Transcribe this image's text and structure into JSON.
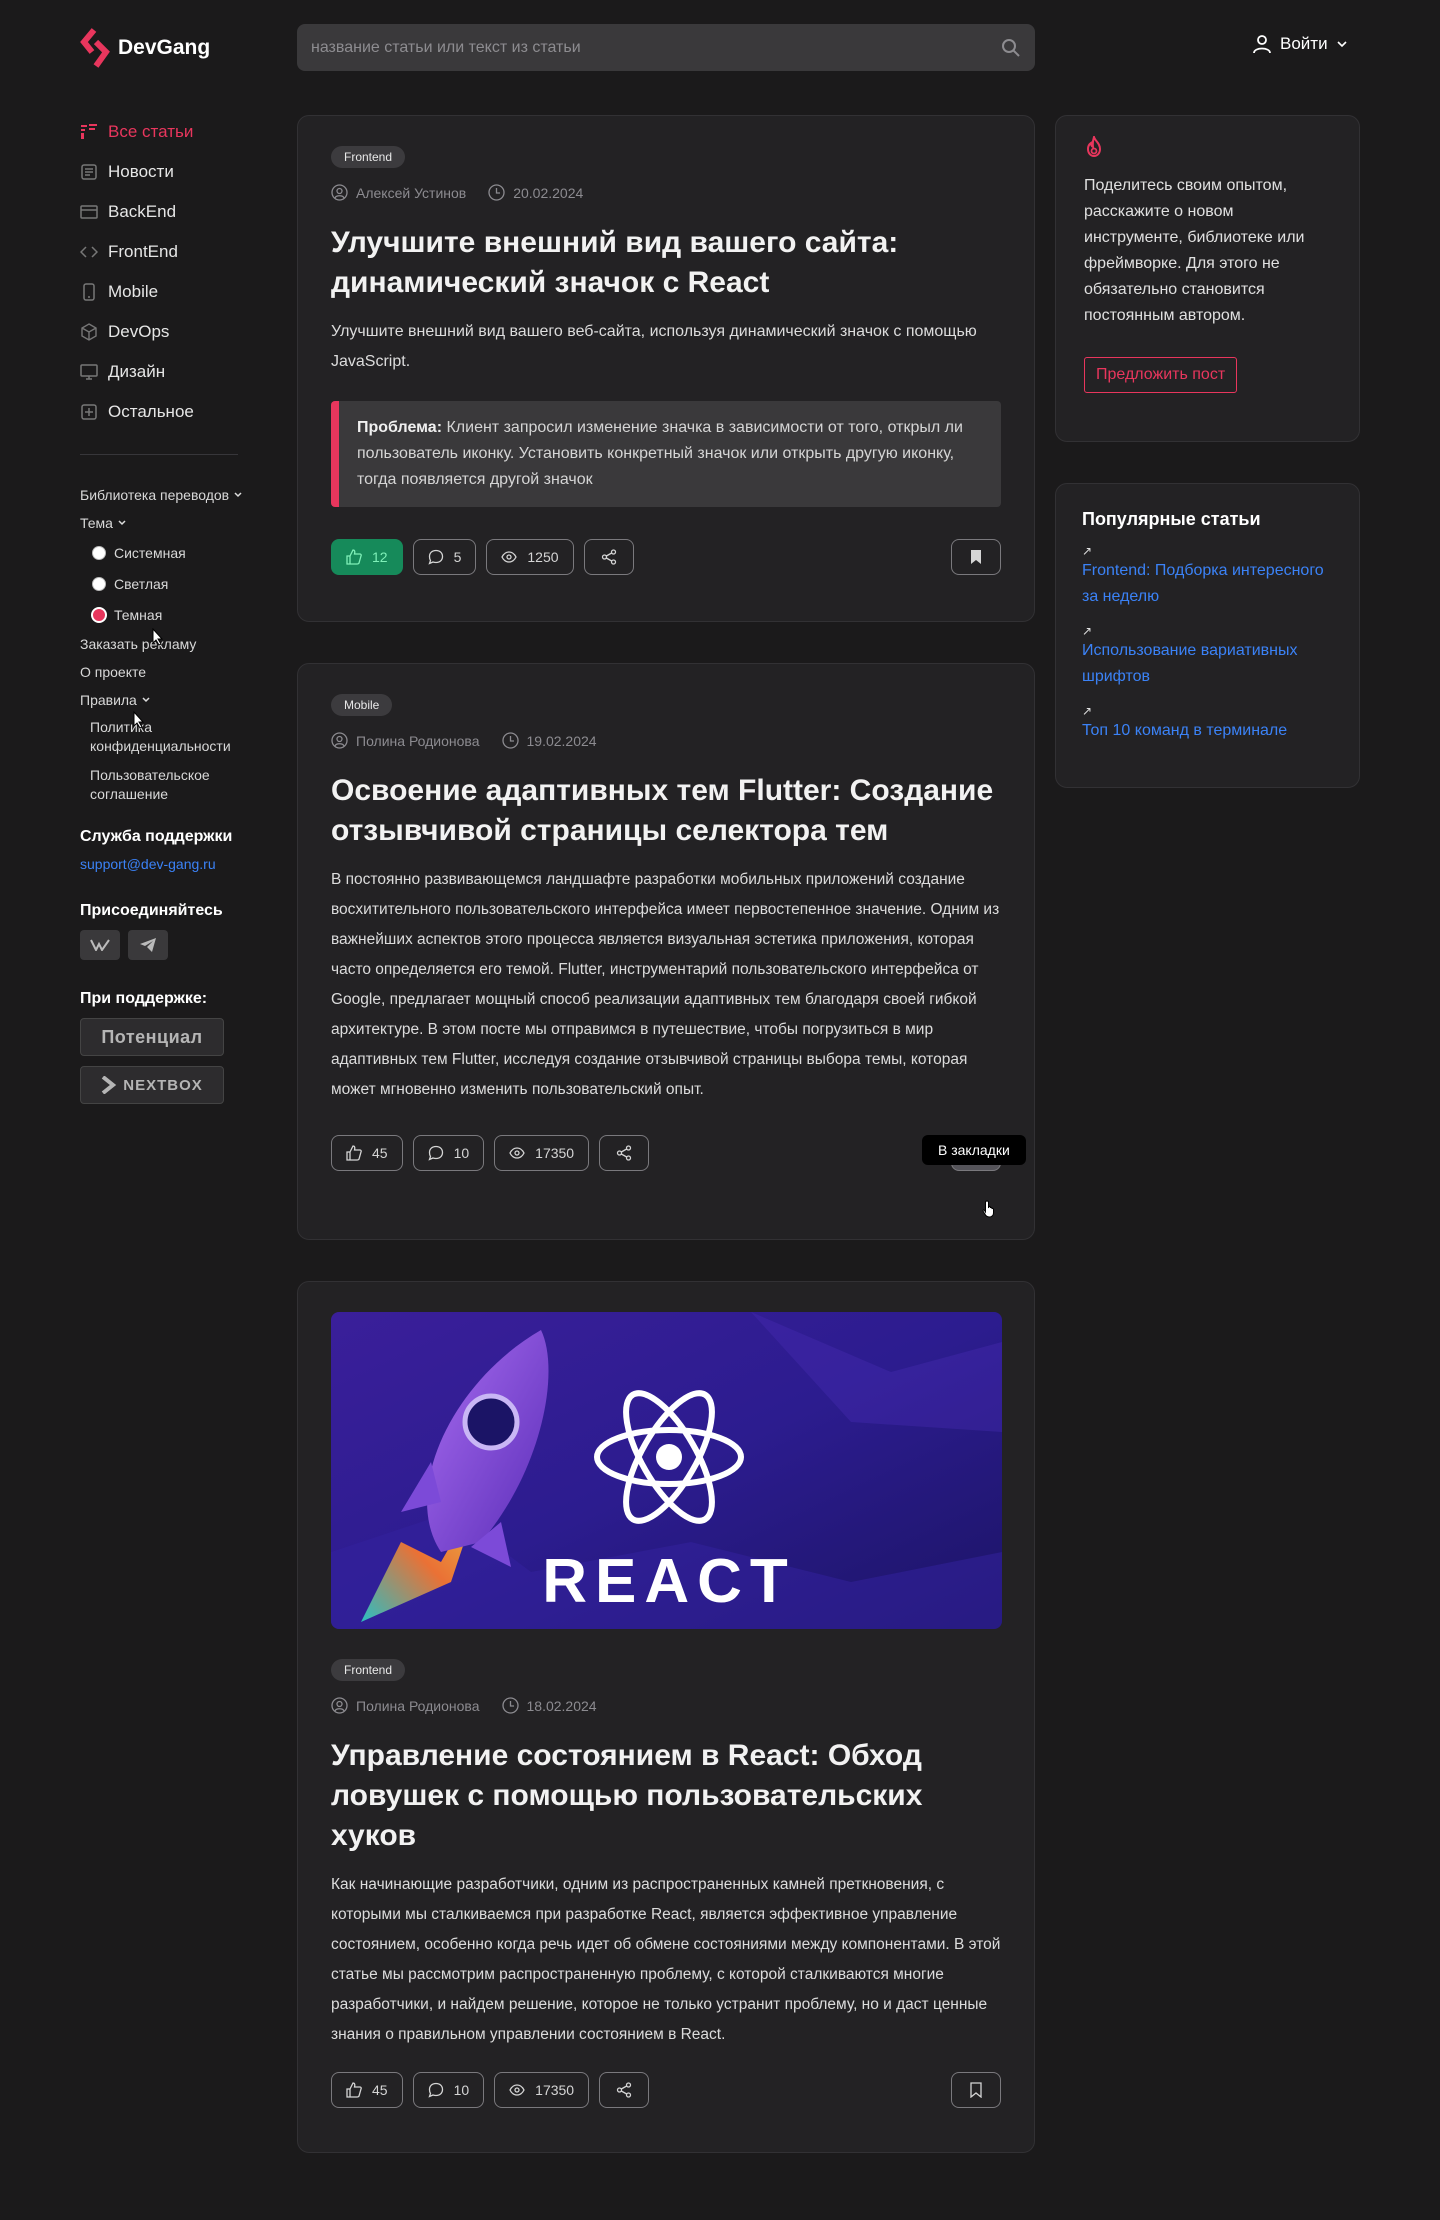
{
  "brand": {
    "name": "DevGang",
    "accent": "#e8365d"
  },
  "search": {
    "placeholder": "название статьи или текст из статьи"
  },
  "header": {
    "login_label": "Войти"
  },
  "nav": [
    {
      "label": "Все статьи",
      "icon": "all-articles-icon"
    },
    {
      "label": "Новости",
      "icon": "news-icon"
    },
    {
      "label": "BackEnd",
      "icon": "backend-icon"
    },
    {
      "label": "FrontEnd",
      "icon": "code-icon"
    },
    {
      "label": "Mobile",
      "icon": "mobile-icon"
    },
    {
      "label": "DevOps",
      "icon": "cube-icon"
    },
    {
      "label": "Дизайн",
      "icon": "monitor-icon"
    },
    {
      "label": "Остальное",
      "icon": "other-icon"
    }
  ],
  "sidebar": {
    "translations": "Библиотека переводов",
    "theme": "Тема",
    "theme_options": [
      "Системная",
      "Светлая",
      "Темная"
    ],
    "theme_selected": "Темная",
    "ads": "Заказать рекламу",
    "about": "О проекте",
    "rules": "Правила",
    "rules_links": [
      "Политика конфиденциальности",
      "Пользовательское соглашение"
    ],
    "support_title": "Служба поддержки",
    "support_email": "support@dev-gang.ru",
    "join_title": "Присоединяйтесь",
    "social": [
      "VK",
      "Telegram"
    ],
    "sponsors_title": "При поддержке:",
    "sponsors": [
      "Потенциал",
      "NEXTBOX"
    ]
  },
  "articles": [
    {
      "tag": "Frontend",
      "author": "Алексей Устинов",
      "date": "20.02.2024",
      "title": "Улучшите внешний вид вашего сайта: динамический значок с React",
      "excerpt": "Улучшите внешний вид вашего веб-сайта, используя динамический значок с помощью JavaScript.",
      "problem_label": "Проблема:",
      "problem_text": " Клиент запросил изменение значка в зависимости от того, открыл ли пользователь иконку. Установить конкретный значок или открыть другую иконку, тогда появляется другой значок",
      "likes": "12",
      "comments": "5",
      "views": "1250",
      "liked": true
    },
    {
      "tag": "Mobile",
      "author": "Полина Родионова",
      "date": "19.02.2024",
      "title": "Освоение адаптивных тем Flutter: Создание отзывчивой страницы селектора тем",
      "excerpt": "В постоянно развивающемся ландшафте разработки мобильных приложений создание восхитительного пользовательского интерфейса имеет первостепенное значение. Одним из важнейших аспектов этого процесса является визуальная эстетика приложения, которая часто определяется его темой. Flutter, инструментарий пользовательского интерфейса от Google, предлагает мощный способ реализации адаптивных тем благодаря своей гибкой архитектуре. В этом посте мы отправимся в путешествие, чтобы погрузиться в мир адаптивных тем Flutter, исследуя создание отзывчивой страницы выбора темы, которая может мгновенно изменить пользовательский опыт.",
      "likes": "45",
      "comments": "10",
      "views": "17350",
      "bookmark_tooltip": "В закладки"
    },
    {
      "tag": "Frontend",
      "author": "Полина Родионова",
      "date": "18.02.2024",
      "cover_text": "REACT",
      "title": "Управление состоянием в React: Обход ловушек с помощью пользовательских хуков",
      "excerpt": "Как начинающие разработчики, одним из распространенных камней преткновения, с которыми мы сталкиваемся при разработке React, является эффективное управление состоянием, особенно когда речь идет об обмене состояниями между компонентами. В этой статье мы рассмотрим распространенную проблему, с которой сталкиваются многие разработчики, и найдем решение, которое не только устранит проблему, но и даст ценные знания о правильном управлении состоянием в React.",
      "likes": "45",
      "comments": "10",
      "views": "17350"
    }
  ],
  "aside": {
    "promo_text": "Поделитесь своим опытом, расскажите о новом инструменте, библиотеке или фреймворке. Для этого не обязательно становится постоянным автором.",
    "promo_button": "Предложить пост",
    "popular_title": "Популярные статьи",
    "popular": [
      "Frontend: Подборка интересного за неделю",
      "Использование вариативных шрифтов",
      "Топ 10 команд в терминале"
    ]
  }
}
